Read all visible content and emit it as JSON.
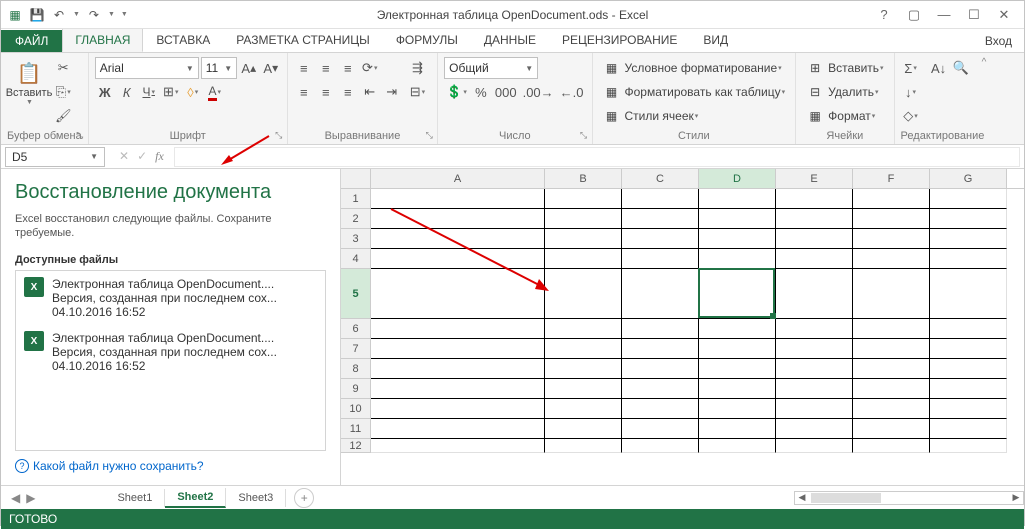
{
  "title": "Электронная таблица OpenDocument.ods - Excel",
  "login": "Вход",
  "tabs": {
    "file": "ФАЙЛ",
    "home": "ГЛАВНАЯ",
    "insert": "ВСТАВКА",
    "layout": "РАЗМЕТКА СТРАНИЦЫ",
    "formulas": "ФОРМУЛЫ",
    "data": "ДАННЫЕ",
    "review": "РЕЦЕНЗИРОВАНИЕ",
    "view": "ВИД"
  },
  "groups": {
    "clipboard": "Буфер обмена",
    "font": "Шрифт",
    "align": "Выравнивание",
    "number": "Число",
    "styles": "Стили",
    "cells": "Ячейки",
    "editing": "Редактирование"
  },
  "clipboard": {
    "paste": "Вставить"
  },
  "font": {
    "name": "Arial",
    "size": "11",
    "bold": "Ж",
    "italic": "К",
    "underline": "Ч"
  },
  "number": {
    "format": "Общий"
  },
  "styles": {
    "cond": "Условное форматирование",
    "table": "Форматировать как таблицу",
    "cell": "Стили ячеек"
  },
  "cells": {
    "insert": "Вставить",
    "delete": "Удалить",
    "format": "Формат"
  },
  "namebox": "D5",
  "recovery": {
    "title": "Восстановление документа",
    "msg": "Excel восстановил следующие файлы.  Сохраните требуемые.",
    "avail": "Доступные файлы",
    "files": [
      {
        "name": "Электронная таблица OpenDocument....",
        "ver": "Версия, созданная при последнем сох...",
        "ts": "04.10.2016 16:52"
      },
      {
        "name": "Электронная таблица OpenDocument....",
        "ver": "Версия, созданная при последнем сох...",
        "ts": "04.10.2016 16:52"
      }
    ],
    "help": "Какой файл нужно сохранить?"
  },
  "cols": [
    "A",
    "B",
    "C",
    "D",
    "E",
    "F",
    "G"
  ],
  "selcol": "D",
  "rows": [
    1,
    2,
    3,
    4,
    5,
    6,
    7,
    8,
    9,
    10,
    11,
    12
  ],
  "selrow": 5,
  "sheets": {
    "s1": "Sheet1",
    "s2": "Sheet2",
    "s3": "Sheet3"
  },
  "status": "ГОТОВО",
  "colw": {
    "A": 174,
    "B": 77,
    "C": 77,
    "D": 77,
    "E": 77,
    "F": 77,
    "G": 77
  },
  "rowh": {
    "1": 20,
    "2": 20,
    "3": 20,
    "4": 20,
    "5": 50,
    "6": 20,
    "7": 20,
    "8": 20,
    "9": 20,
    "10": 20,
    "11": 20,
    "12": 14
  }
}
